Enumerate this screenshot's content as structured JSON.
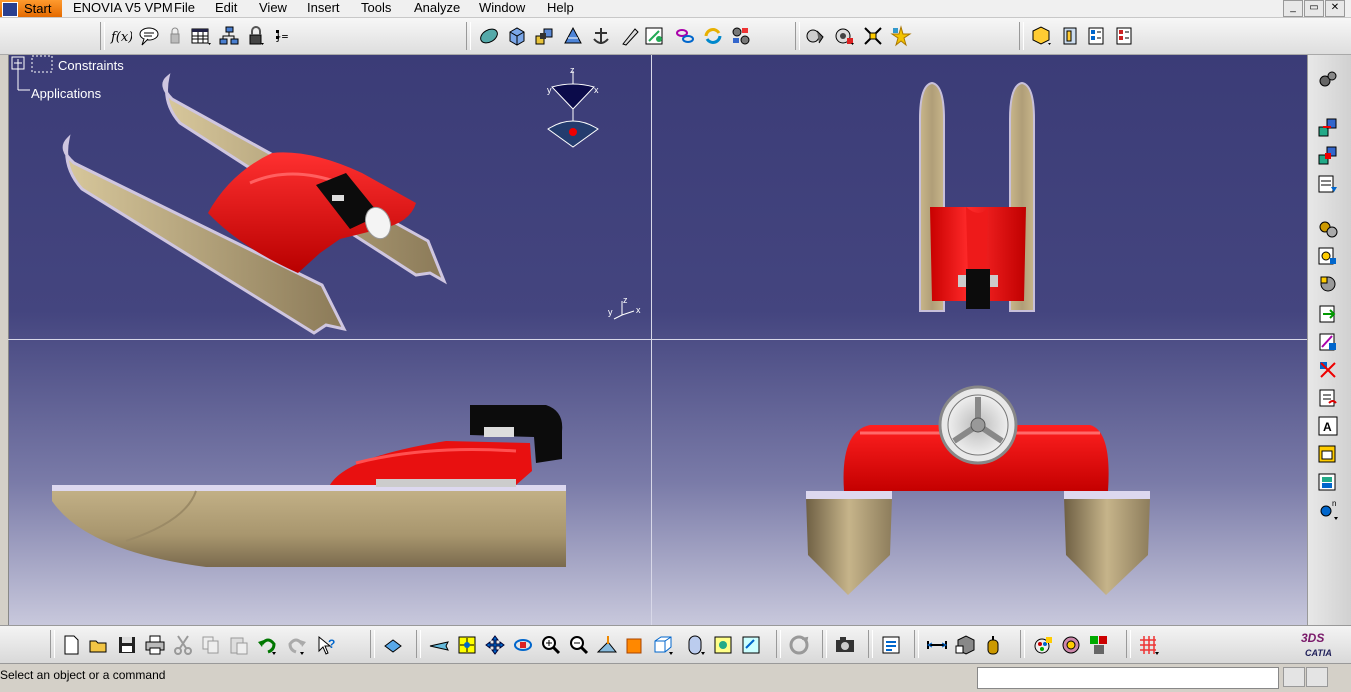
{
  "menubar": {
    "start_label": "Start",
    "items": [
      "ENOVIA V5 VPM",
      "File",
      "Edit",
      "View",
      "Insert",
      "Tools",
      "Analyze",
      "Window",
      "Help"
    ]
  },
  "tree": {
    "root_label": "Constraints",
    "child_label": "Applications"
  },
  "compass": {
    "x": "x",
    "y": "y",
    "z": "z"
  },
  "status": {
    "message": "Select an object or a command",
    "command_value": ""
  },
  "logo": {
    "text": "CATIA",
    "mark": "3DS"
  },
  "colors": {
    "hull": "#b19f77",
    "hull_dark": "#7d6c4f",
    "deck": "#e02020",
    "engine": "#101010",
    "background_top": "#3b3c77",
    "background_bottom": "#c8c8dc",
    "start_button": "#f08018"
  },
  "icons": {
    "top_toolbar": [
      "formula-icon",
      "comment-icon",
      "lock-icon",
      "table-icon",
      "hierarchy-icon",
      "padlock-icon",
      "parameters-icon",
      "sphere-icon",
      "cube-icon",
      "assembly-icon",
      "thread-icon",
      "anchor-icon",
      "pencil-icon",
      "measure-icon",
      "chain-icon",
      "refresh-icon",
      "gear-network-icon",
      "clash-icon",
      "sectioning-icon",
      "distance-icon",
      "star-icon",
      "catalog-icon",
      "material-icon",
      "bom-icon",
      "report-icon"
    ],
    "right_toolbar": [
      "settings-icon",
      "constraint-icon",
      "fix-icon",
      "coincidence-icon",
      "contact-icon",
      "offset-icon",
      "angle-icon",
      "fix-together-icon",
      "quick-constraint-icon",
      "flexible-icon",
      "change-constraint-icon",
      "reuse-pattern-icon",
      "table-icon",
      "scene-icon",
      "more-icon"
    ],
    "bottom_toolbar": [
      "new-icon",
      "open-icon",
      "save-icon",
      "print-icon",
      "cut-icon",
      "copy-icon",
      "paste-icon",
      "undo-icon",
      "redo-icon",
      "whats-this-icon",
      "spec-tree-icon",
      "fly-mode-icon",
      "fit-all-icon",
      "pan-icon",
      "rotate-icon",
      "zoom-in-icon",
      "zoom-out-icon",
      "normal-view-icon",
      "iso-view-icon",
      "view-cube-icon",
      "shading-icon",
      "hide-show-icon",
      "swap-space-icon",
      "update-icon",
      "camera-icon",
      "catalog-browser-icon",
      "measure-between-icon",
      "measure-item-icon",
      "measure-inertia-icon",
      "apply-material-icon",
      "sectioning-icon",
      "clash-icon",
      "grid-icon"
    ]
  }
}
